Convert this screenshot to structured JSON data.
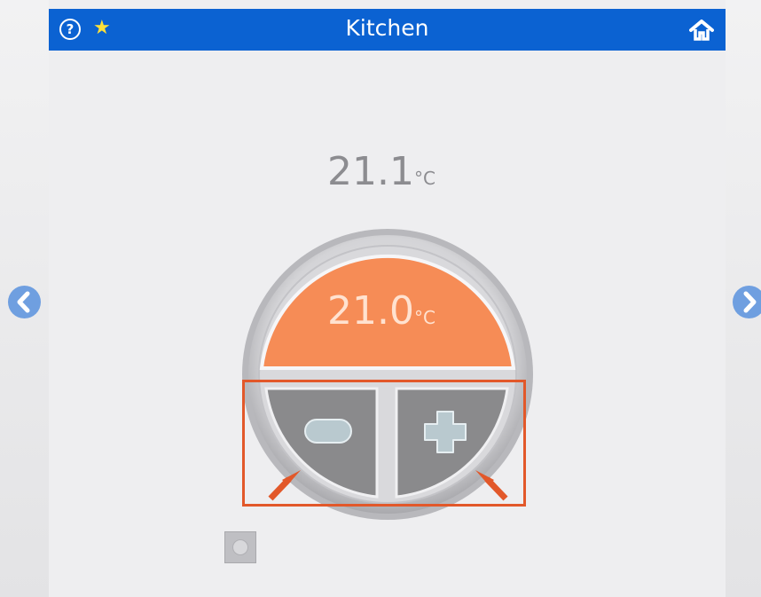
{
  "header": {
    "title": "Kitchen",
    "help_symbol": "?",
    "star_symbol": "★",
    "icons": [
      "help-circle-icon",
      "star-icon",
      "home-icon"
    ]
  },
  "thermostat": {
    "current_value": "21.1",
    "current_unit": "°C",
    "setpoint_value": "21.0",
    "setpoint_unit": "°C",
    "decrease_icon": "minus-icon",
    "increase_icon": "plus-icon"
  },
  "navigation": {
    "prev_icon": "chevron-left-icon",
    "next_icon": "chevron-right-icon"
  },
  "colors": {
    "header_bg": "#0b62d2",
    "setpoint_orange": "#f68c56",
    "button_gray": "#8a8a8c",
    "highlight": "#e2582a",
    "nav_arrow": "#6f9fe0"
  }
}
